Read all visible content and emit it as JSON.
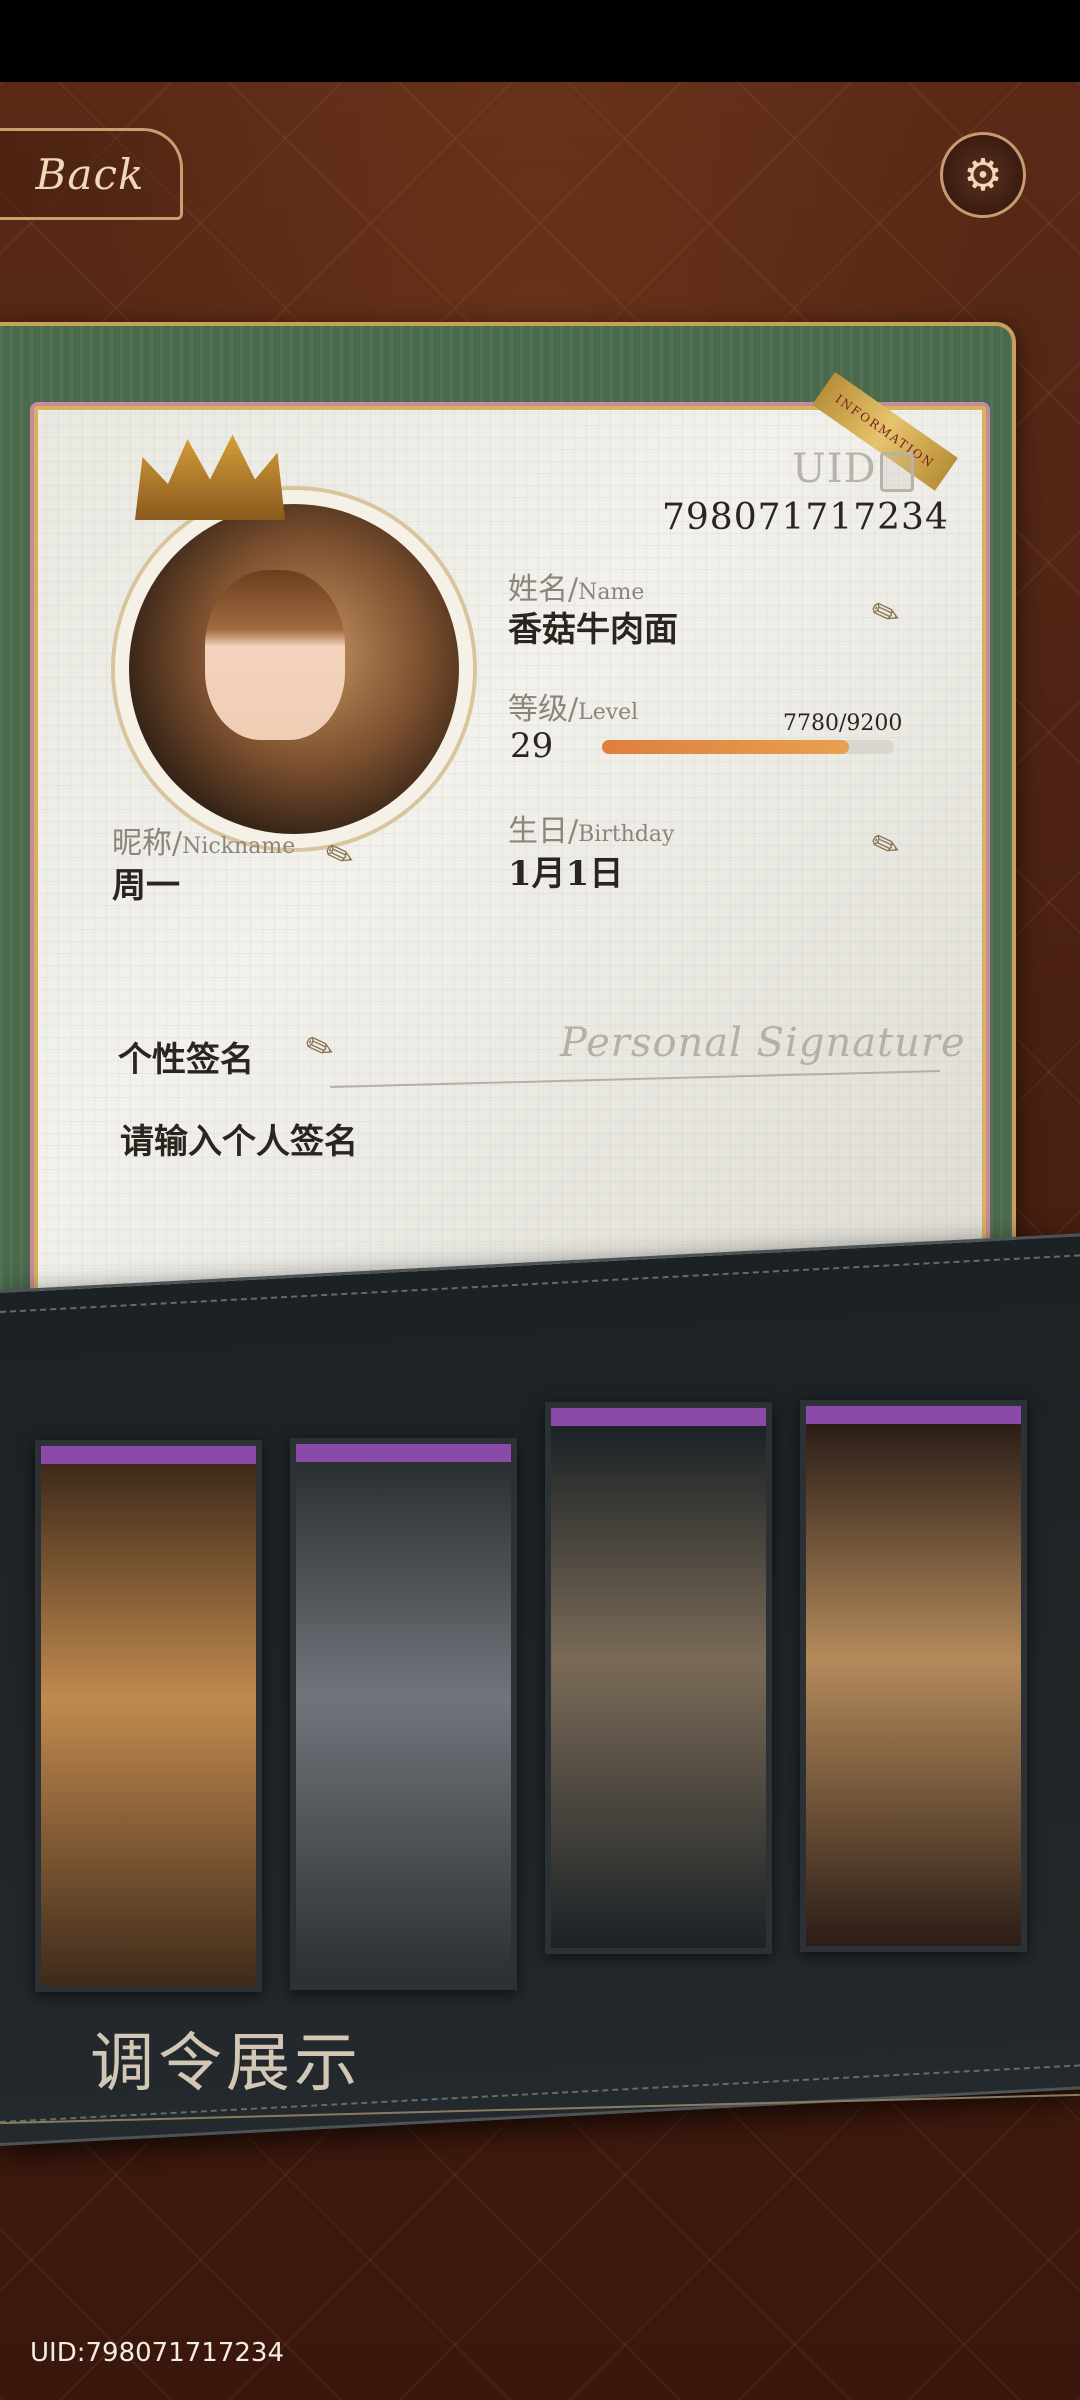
{
  "header": {
    "back_label": "Back",
    "settings_icon": "gear-icon"
  },
  "profile": {
    "uid_label": "UID",
    "uid_value": "798071717234",
    "ribbon_text": "INFORMATION",
    "name_label": "姓名/",
    "name_label_en": "Name",
    "name_value": "香菇牛肉面",
    "level_label": "等级/",
    "level_label_en": "Level",
    "level_value": "29",
    "level_progress_text": "7780/9200",
    "level_progress": 0.846,
    "nickname_label": "昵称/",
    "nickname_label_en": "Nickname",
    "nickname_value": "周一",
    "birthday_label": "生日/",
    "birthday_label_en": "Birthday",
    "birthday_value": "1月1日",
    "signature_title": "个性签名",
    "signature_script": "Personal Signature",
    "signature_placeholder": "请输入个人签名"
  },
  "gallery": {
    "title": "调令展示",
    "cards": [
      {
        "name": "gallery-card-1",
        "colors": [
          "#3e2a1a",
          "#c18a4e"
        ]
      },
      {
        "name": "gallery-card-2",
        "colors": [
          "#2a2f33",
          "#6f757a"
        ]
      },
      {
        "name": "gallery-card-3",
        "colors": [
          "#1b2226",
          "#7a6a57"
        ]
      },
      {
        "name": "gallery-card-4",
        "colors": [
          "#2b1d17",
          "#b48a5b"
        ]
      }
    ]
  },
  "footer": {
    "uid_text": "UID:798071717234"
  },
  "colors": {
    "accent_green": "#4a6a4c",
    "progress_orange": "#de7f3a",
    "gallery_stripe": "#8a4aa8"
  }
}
